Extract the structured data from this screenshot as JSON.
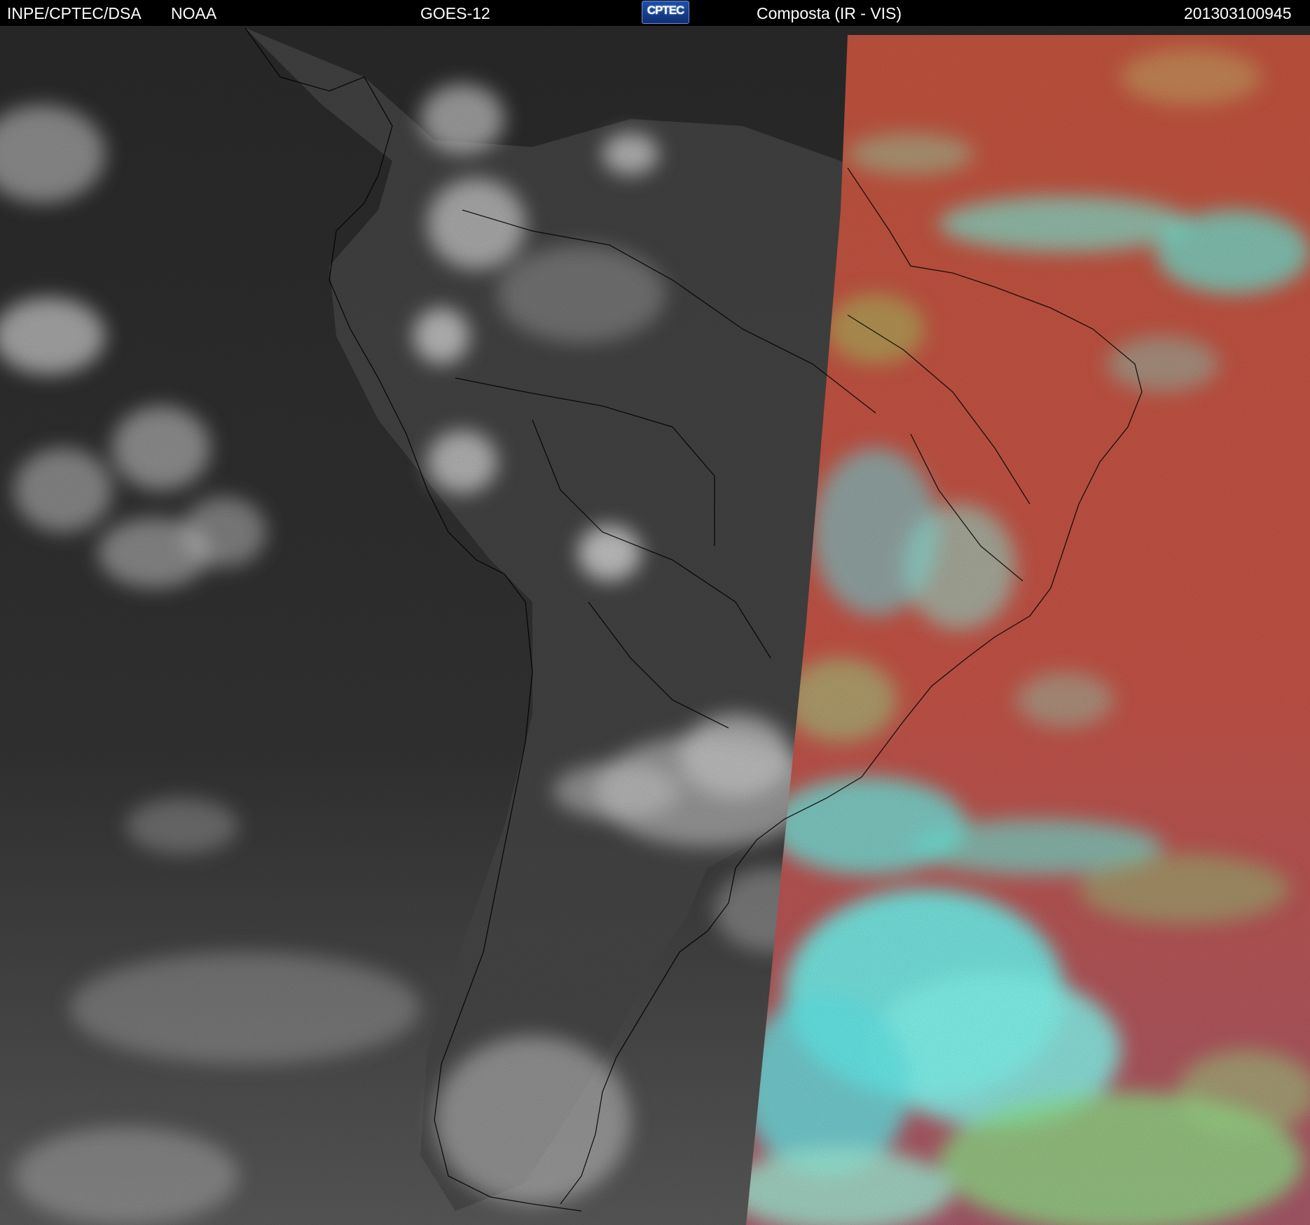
{
  "header": {
    "institution": "INPE/CPTEC/DSA",
    "agency": "NOAA",
    "satellite": "GOES-12",
    "logo": "CPTEC",
    "product": "Composta (IR - VIS)",
    "timestamp": "201303100945"
  },
  "colors": {
    "ir_background": "#2c2c2c",
    "vis_land_ocean_red": "#c0554a",
    "vis_cloud_cyan": "#5cf0d8",
    "vis_cloud_green": "#8be07a",
    "coastline": "#000000"
  }
}
